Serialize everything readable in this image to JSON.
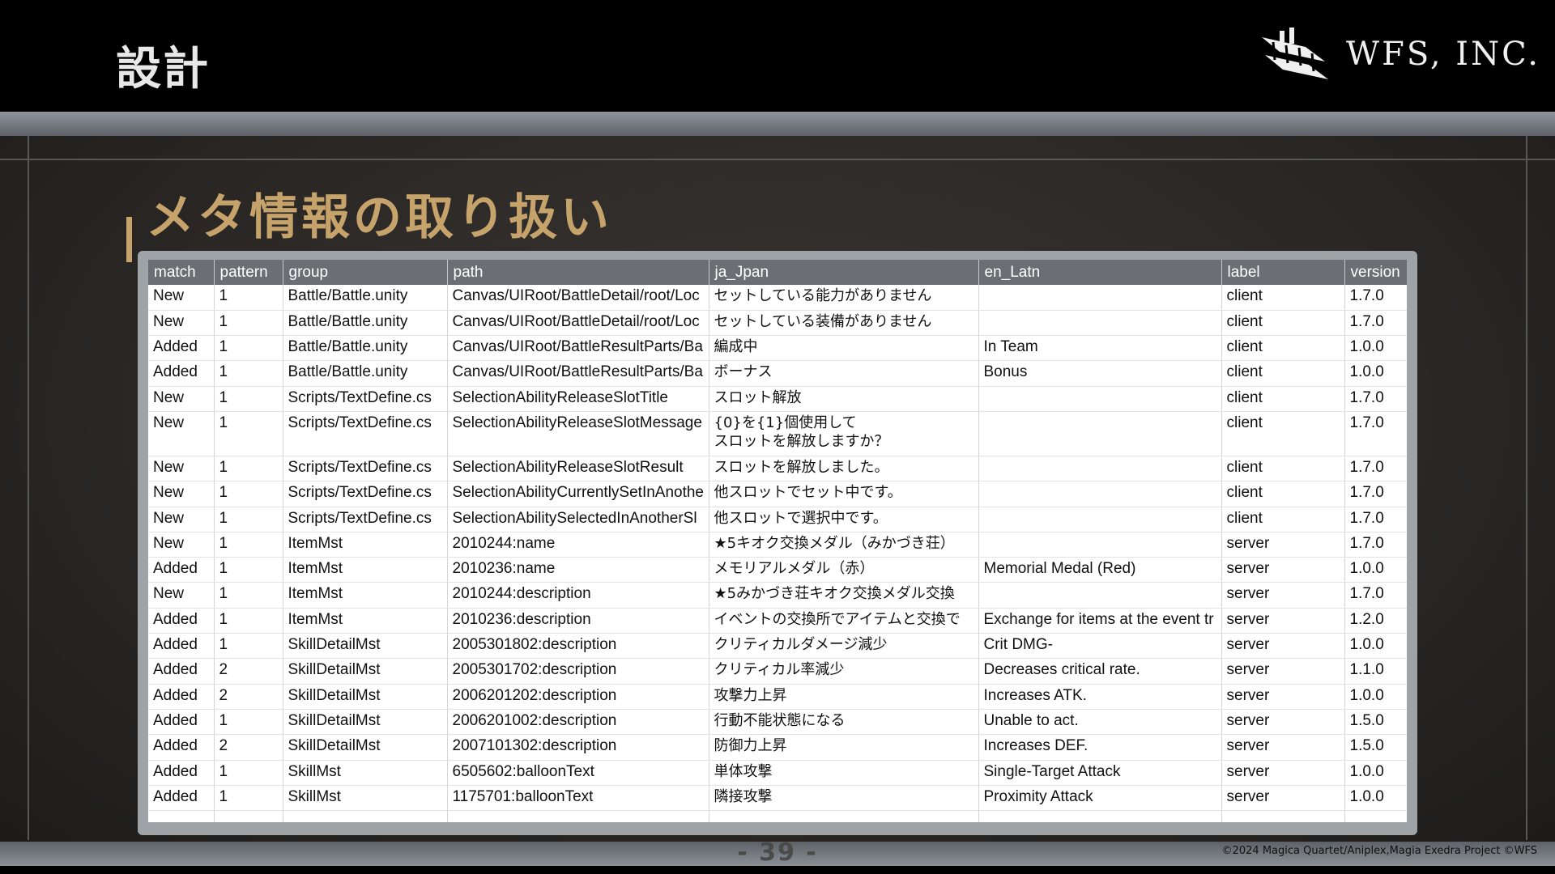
{
  "header": {
    "title": "設計",
    "logo_text": "WFS, INC.",
    "logo_icon": "biplane-icon"
  },
  "slide": {
    "section_title": "メタ情報の取り扱い",
    "page_number": "- 39 -",
    "copyright": "©2024 Magica Quartet/Aniplex,Magia Exedra Project ©WFS"
  },
  "table": {
    "columns": [
      "match",
      "pattern",
      "group",
      "path",
      "ja_Jpan",
      "en_Latn",
      "label",
      "version"
    ],
    "rows": [
      [
        "New",
        "1",
        "Battle/Battle.unity",
        "Canvas/UIRoot/BattleDetail/root/Loc",
        "セットしている能力がありません",
        "",
        "client",
        "1.7.0"
      ],
      [
        "New",
        "1",
        "Battle/Battle.unity",
        "Canvas/UIRoot/BattleDetail/root/Loc",
        "セットしている装備がありません",
        "",
        "client",
        "1.7.0"
      ],
      [
        "Added",
        "1",
        "Battle/Battle.unity",
        "Canvas/UIRoot/BattleResultParts/Ba",
        "編成中",
        "In Team",
        "client",
        "1.0.0"
      ],
      [
        "Added",
        "1",
        "Battle/Battle.unity",
        "Canvas/UIRoot/BattleResultParts/Ba",
        "ボーナス",
        "Bonus",
        "client",
        "1.0.0"
      ],
      [
        "New",
        "1",
        "Scripts/TextDefine.cs",
        "SelectionAbilityReleaseSlotTitle",
        "スロット解放",
        "",
        "client",
        "1.7.0"
      ],
      [
        "New",
        "1",
        "Scripts/TextDefine.cs",
        "SelectionAbilityReleaseSlotMessage",
        "{0}を{1}個使用して\nスロットを解放しますか？",
        "",
        "client",
        "1.7.0"
      ],
      [
        "New",
        "1",
        "Scripts/TextDefine.cs",
        "SelectionAbilityReleaseSlotResult",
        "スロットを解放しました。",
        "",
        "client",
        "1.7.0"
      ],
      [
        "New",
        "1",
        "Scripts/TextDefine.cs",
        "SelectionAbilityCurrentlySetInAnothe",
        "他スロットでセット中です。",
        "",
        "client",
        "1.7.0"
      ],
      [
        "New",
        "1",
        "Scripts/TextDefine.cs",
        "SelectionAbilitySelectedInAnotherSl",
        "他スロットで選択中です。",
        "",
        "client",
        "1.7.0"
      ],
      [
        "New",
        "1",
        "ItemMst",
        "2010244:name",
        "★5キオク交換メダル（みかづき荘）",
        "",
        "server",
        "1.7.0"
      ],
      [
        "Added",
        "1",
        "ItemMst",
        "2010236:name",
        "メモリアルメダル（赤）",
        "Memorial Medal (Red)",
        "server",
        "1.0.0"
      ],
      [
        "New",
        "1",
        "ItemMst",
        "2010244:description",
        "★5みかづき荘キオク交換メダル交換",
        "",
        "server",
        "1.7.0"
      ],
      [
        "Added",
        "1",
        "ItemMst",
        "2010236:description",
        "イベントの交換所でアイテムと交換で",
        "Exchange for items at the event tr",
        "server",
        "1.2.0"
      ],
      [
        "Added",
        "1",
        "SkillDetailMst",
        "2005301802:description",
        "クリティカルダメージ減少",
        "Crit DMG-",
        "server",
        "1.0.0"
      ],
      [
        "Added",
        "2",
        "SkillDetailMst",
        "2005301702:description",
        "クリティカル率減少",
        "Decreases critical rate.",
        "server",
        "1.1.0"
      ],
      [
        "Added",
        "2",
        "SkillDetailMst",
        "2006201202:description",
        "攻撃力上昇",
        "Increases ATK.",
        "server",
        "1.0.0"
      ],
      [
        "Added",
        "1",
        "SkillDetailMst",
        "2006201002:description",
        "行動不能状態になる",
        "Unable to act.",
        "server",
        "1.5.0"
      ],
      [
        "Added",
        "2",
        "SkillDetailMst",
        "2007101302:description",
        "防御力上昇",
        "Increases DEF.",
        "server",
        "1.5.0"
      ],
      [
        "Added",
        "1",
        "SkillMst",
        "6505602:balloonText",
        "単体攻撃",
        "Single-Target Attack",
        "server",
        "1.0.0"
      ],
      [
        "Added",
        "1",
        "SkillMst",
        "1175701:balloonText",
        "隣接攻撃",
        "Proximity Attack",
        "server",
        "1.0.0"
      ]
    ]
  }
}
